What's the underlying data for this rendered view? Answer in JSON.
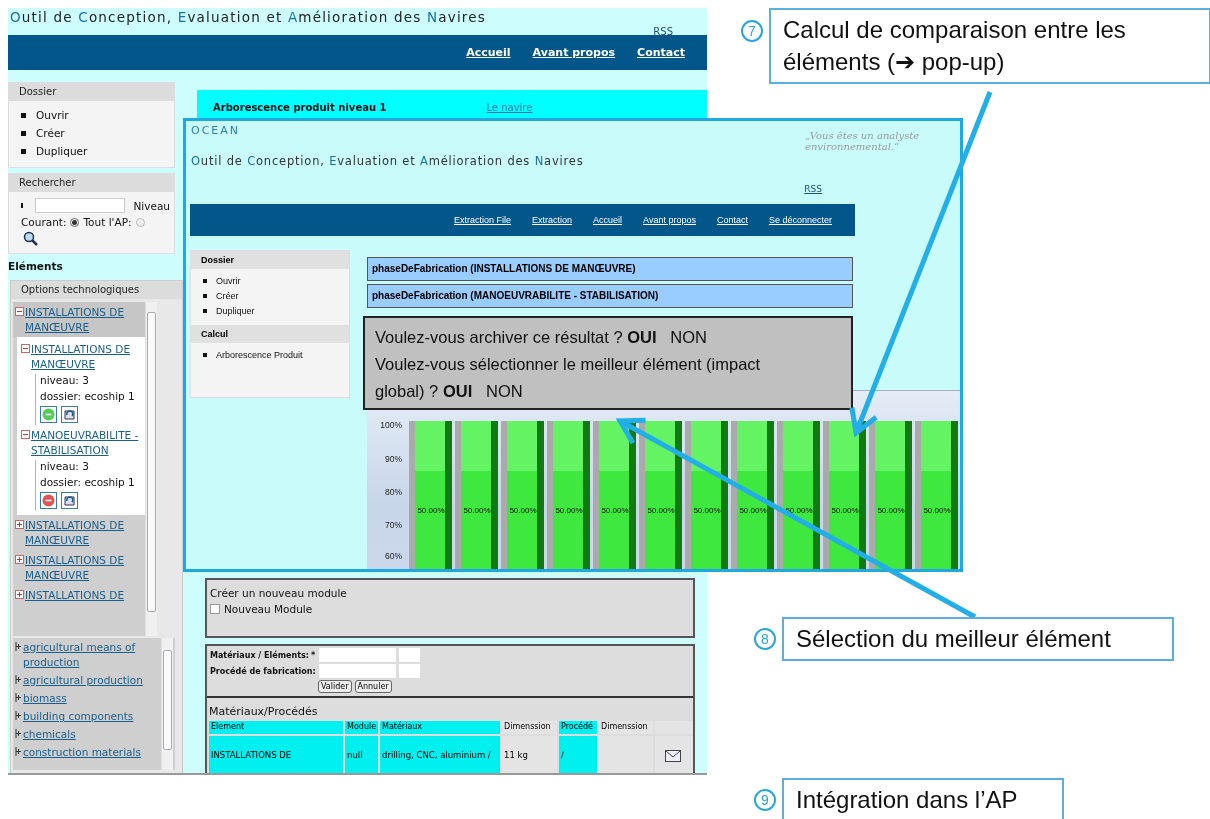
{
  "app": {
    "title": "Outil de Conception, Evaluation et Amélioration des Navires",
    "rss": "RSS",
    "nav": [
      "Accueil",
      "Avant propos",
      "Contact"
    ]
  },
  "sidebar": {
    "panels": [
      {
        "title": "Dossier",
        "items": [
          "Ouvrir",
          "Créer",
          "Dupliquer"
        ]
      }
    ],
    "search": {
      "title": "Rechercher",
      "label": "Niveau",
      "radios": [
        {
          "label": "Courant:",
          "selected": true
        },
        {
          "label": "Tout l'AP:",
          "selected": false
        }
      ]
    },
    "elements_label": "Eléments",
    "options": {
      "title": "Options technologiques",
      "tree": [
        {
          "label": "INSTALLATIONS DE MANŒUVRE",
          "expanded": true,
          "children": [
            {
              "label": "INSTALLATIONS DE MANŒUVRE",
              "expanded": true,
              "details": [
                "niveau: 3",
                "dossier: ecoship 1"
              ],
              "color": "#55cc55"
            },
            {
              "label": "MANOEUVRABILITE - STABILISATION",
              "expanded": true,
              "details": [
                "niveau: 3",
                "dossier: ecoship 1"
              ],
              "color": "#dd5555"
            }
          ]
        },
        {
          "label": "INSTALLATIONS DE MANŒUVRE",
          "expanded": false
        },
        {
          "label": "INSTALLATIONS DE MANŒUVRE",
          "expanded": false
        },
        {
          "label": "INSTALLATIONS DE",
          "expanded": false
        }
      ],
      "categories": [
        "agricultural means of production",
        "agricultural production",
        "biomass",
        "building components",
        "chemicals",
        "construction materials"
      ]
    }
  },
  "main": {
    "banner": {
      "label": "Arborescence produit niveau 1",
      "value": "Le navire"
    },
    "module_panel": {
      "title": "Créer un nouveau module",
      "checkbox": {
        "label": "Nouveau Module",
        "checked": false
      }
    },
    "form": {
      "fields": [
        {
          "label": "Matériaux / Eléments:",
          "required_mark": "*"
        },
        {
          "label": "Procédé de fabrication:"
        }
      ],
      "buttons": [
        "Valider",
        "Annuler"
      ]
    },
    "table": {
      "title": "Matériaux/Procédés",
      "columns": [
        {
          "label": "Element",
          "highlight": true
        },
        {
          "label": "Module",
          "highlight": true
        },
        {
          "label": "Matériaux",
          "highlight": true
        },
        {
          "label": "Dimenssion",
          "highlight": false
        },
        {
          "label": "Procédé",
          "highlight": true
        },
        {
          "label": "Dimenssion",
          "highlight": false
        }
      ],
      "rows": [
        {
          "cells": [
            "INSTALLATIONS DE",
            "null",
            "drilling, CNC, aluminium /",
            "11 kg",
            "/"
          ]
        }
      ]
    }
  },
  "popup_window": {
    "brand": "OCEAN",
    "title": "Outil de Conception, Evaluation et Amélioration des Navires",
    "quote": "„Vous êtes un analyste environnemental.“",
    "rss": "RSS",
    "nav": [
      "Extraction File",
      "Extraction",
      "Accueil",
      "Avant propos",
      "Contact",
      "Se déconnecter"
    ],
    "sidebar": [
      {
        "title": "Dossier",
        "items": [
          "Ouvrir",
          "Créer",
          "Dupliquer"
        ]
      },
      {
        "title": "Calcul",
        "items": [
          "Arborescence Produit"
        ]
      }
    ],
    "phases": [
      "phaseDeFabrication (INSTALLATIONS DE MANŒUVRE)",
      "phaseDeFabrication (MANOEUVRABILITE - STABILISATION)"
    ],
    "dialog": [
      "Voulez-vous archiver ce résultat ? **OUI**   NON",
      "Voulez-vous sélectionner le meilleur élément (impact global) ? **OUI**   NON"
    ],
    "chart": {
      "yticks": [
        "100%",
        "90%",
        "80%",
        "70%",
        "60%"
      ],
      "bar_labels": [
        "50.00%",
        "50.00%",
        "50.00%",
        "50.00%",
        "50.00%",
        "50.00%",
        "50.00%",
        "50.00%",
        "50.00%",
        "50.00%",
        "50.00%",
        "50.00%"
      ]
    }
  },
  "callouts": [
    {
      "number": "7",
      "text": "Calcul de comparaison entre les éléments (➔ pop-up)"
    },
    {
      "number": "8",
      "text": "Sélection du meilleur élément"
    },
    {
      "number": "9",
      "text": "Intégration dans l’AP"
    }
  ]
}
